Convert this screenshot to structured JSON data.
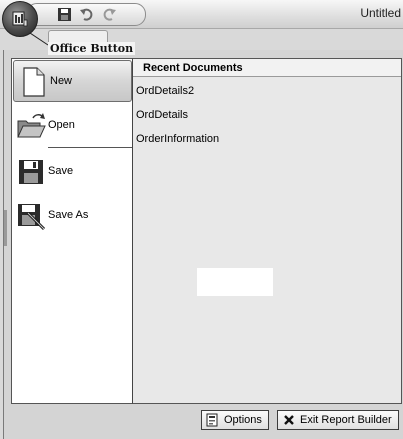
{
  "window": {
    "title": "Untitled"
  },
  "office_button": {
    "tooltip": "Office Button"
  },
  "menu": {
    "items": [
      {
        "label": "New",
        "icon": "new-document-icon"
      },
      {
        "label": "Open",
        "icon": "open-folder-icon"
      },
      {
        "label": "Save",
        "icon": "floppy-disk-icon"
      },
      {
        "label": "Save As",
        "icon": "save-as-icon"
      }
    ],
    "selected": "New"
  },
  "recent": {
    "header": "Recent Documents",
    "items": [
      "OrdDetails2",
      "OrdDetails",
      "OrderInformation"
    ]
  },
  "footer": {
    "options_label": "Options",
    "exit_label": "Exit Report Builder"
  }
}
